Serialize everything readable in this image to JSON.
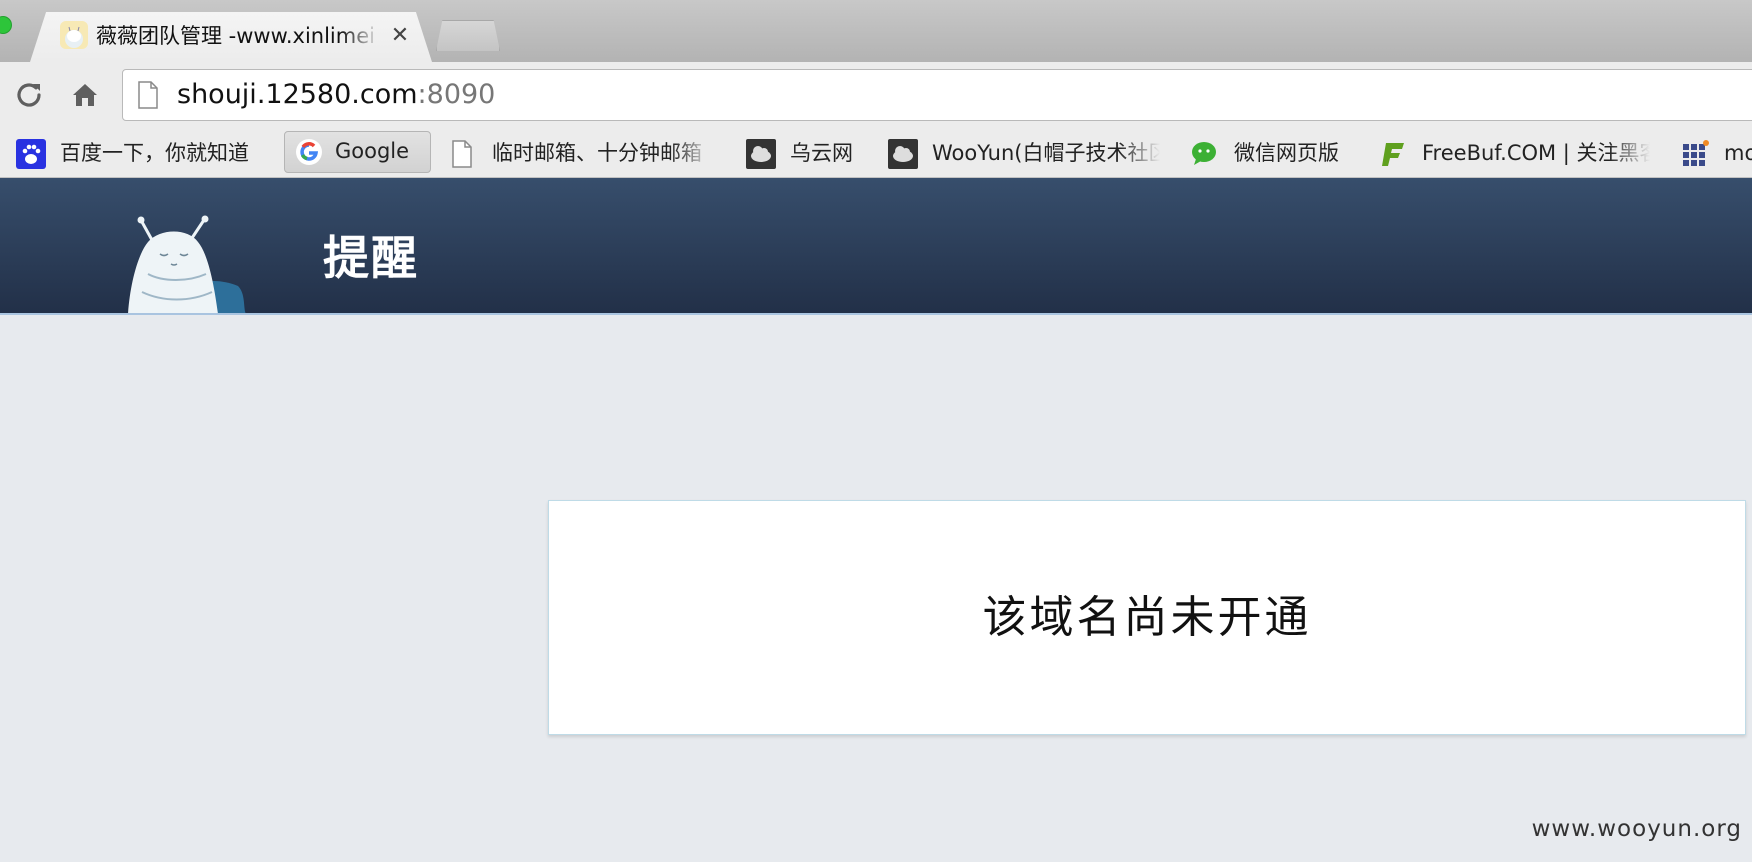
{
  "browser": {
    "tab": {
      "title": "薇薇团队管理 -www.xinlimei",
      "close_glyph": "✕",
      "favicon": "cartoon-mascot-icon"
    },
    "new_tab": "new-tab-icon",
    "toolbar": {
      "reload_icon": "reload-icon",
      "home_icon": "home-icon"
    },
    "address_bar": {
      "host": "shouji.12580.com",
      "port": ":8090",
      "page_icon": "page-icon"
    },
    "bookmarks": [
      {
        "label": "百度一下，你就知道",
        "icon": "baidu-paw-icon"
      },
      {
        "label": "Google",
        "icon": "google-icon"
      },
      {
        "label": "临时邮箱、十分钟邮箱",
        "icon": "page-icon"
      },
      {
        "label": "乌云网",
        "icon": "wooyun-cloud-icon"
      },
      {
        "label": "WooYun(白帽子技术社区)",
        "icon": "wooyun-cloud-icon"
      },
      {
        "label": "微信网页版",
        "icon": "wechat-icon"
      },
      {
        "label": "FreeBuf.COM | 关注黑客",
        "icon": "freebuf-icon"
      },
      {
        "label": "mo",
        "icon": "apps-grid-icon"
      }
    ]
  },
  "page": {
    "header_title": "提醒",
    "header_logo": "mascot-logo",
    "notice_message": "该域名尚未开通",
    "watermark": "www.wooyun.org"
  },
  "colors": {
    "header_bg": "#2c3d57",
    "page_bg": "#e7eaee",
    "notice_border": "#bfdbe7"
  }
}
